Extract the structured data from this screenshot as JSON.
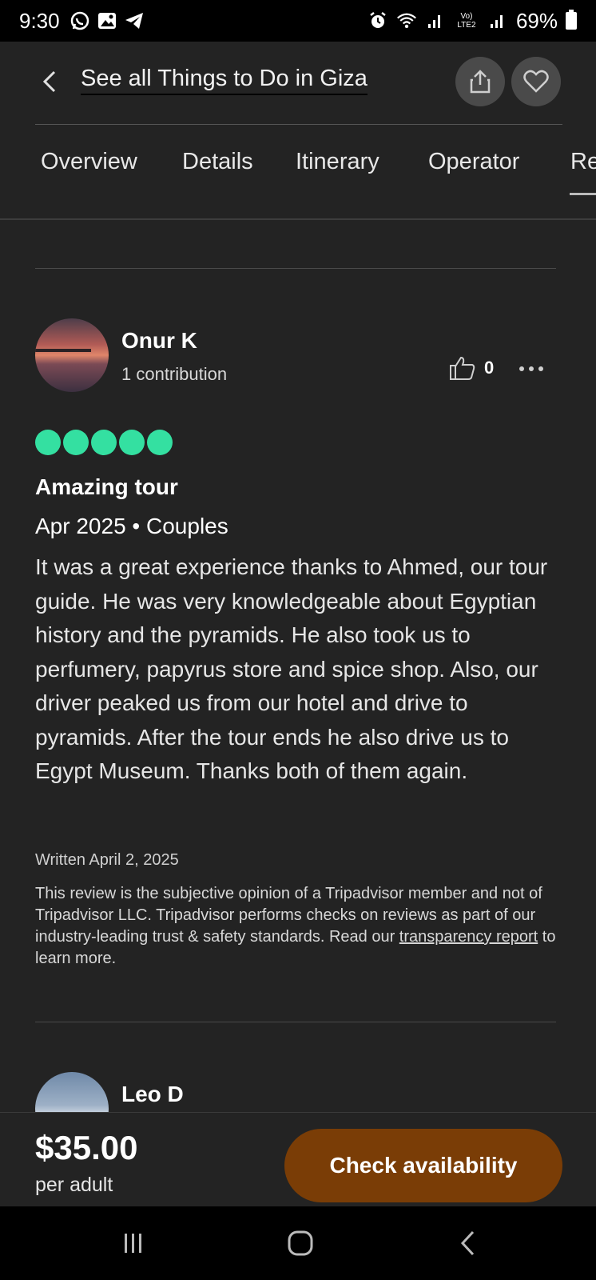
{
  "status_bar": {
    "time": "9:30",
    "battery": "69%",
    "icons": [
      "whatsapp-icon",
      "gallery-icon",
      "telegram-icon",
      "alarm-icon",
      "wifi-icon",
      "signal-icon",
      "volte-icon",
      "signal-icon",
      "battery-icon"
    ],
    "volte_label": "Vo) LTE2"
  },
  "topbar": {
    "back_link": "See all Things to Do in Giza",
    "icons": [
      "back-chevron-icon",
      "share-icon",
      "heart-icon"
    ]
  },
  "tabs": [
    {
      "label": "Overview"
    },
    {
      "label": "Details"
    },
    {
      "label": "Itinerary"
    },
    {
      "label": "Operator"
    },
    {
      "label": "Re"
    }
  ],
  "review": {
    "author": "Onur K",
    "contributions": "1 contribution",
    "helpful_count": "0",
    "rating": 5,
    "rating_color": "#34e0a1",
    "title": "Amazing tour",
    "meta": "Apr 2025 • Couples",
    "body": "It was a great experience thanks to Ahmed, our tour guide. He was very knowledgeable about Egyptian history and the pyramids. He also took us to perfumery, papyrus store and spice shop. Also, our driver peaked us from our hotel and drive to pyramids. After the tour ends he also drive us to Egypt Museum. Thanks both of them again.",
    "written": "Written April 2, 2025",
    "disclaimer_pre": "This review is the subjective opinion of a Tripadvisor member and not of Tripadvisor LLC. Tripadvisor performs checks on reviews as part of our industry-leading trust & safety standards. Read our ",
    "disclaimer_link": "transparency report",
    "disclaimer_post": " to learn more."
  },
  "next_review": {
    "author": "Leo D"
  },
  "booking": {
    "price": "$35.00",
    "per": "per adult",
    "cta": "Check availability",
    "cta_color": "#7a3d06"
  },
  "navbar": {
    "icons": [
      "recents-icon",
      "home-icon",
      "back-icon"
    ]
  }
}
